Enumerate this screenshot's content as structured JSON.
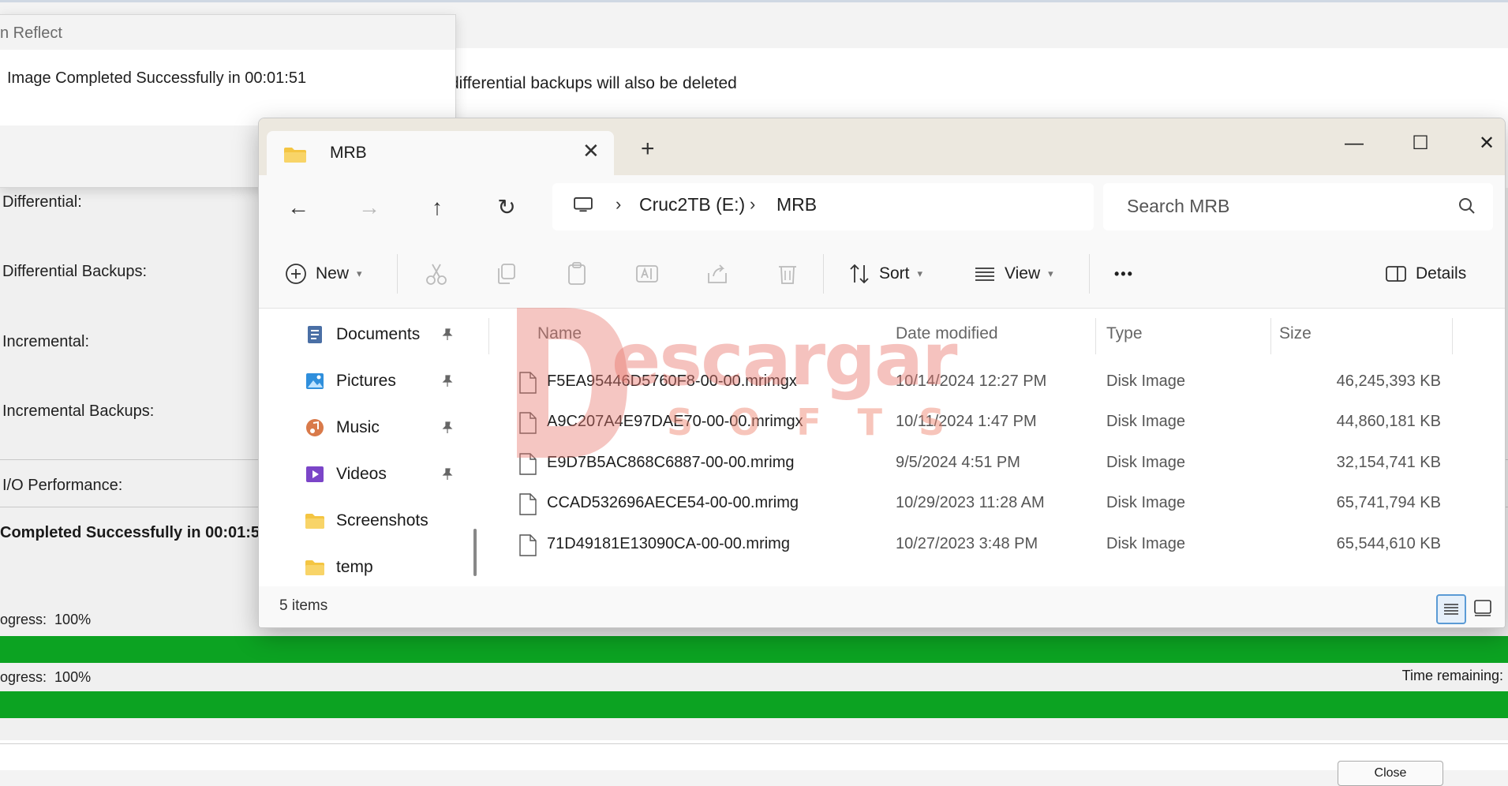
{
  "reflect": {
    "popup_title": "n Reflect",
    "popup_message": "Image Completed Successfully in 00:01:51",
    "note": "differential backups will also be deleted",
    "labels": {
      "differential": "Differential:",
      "differential_backups": "Differential Backups:",
      "incremental": "Incremental:",
      "incremental_backups": "Incremental Backups:",
      "io_performance": "I/O Performance:"
    },
    "completed_text": "Completed Successfully in 00:01:5",
    "progress1": {
      "label": "ogress:",
      "value": "100%",
      "fraction": 1.0
    },
    "progress2": {
      "label": "ogress:",
      "value": "100%",
      "fraction": 1.0
    },
    "time_remaining": "Time remaining:",
    "bottom_button": "Close",
    "bar_color": "#0ca322"
  },
  "explorer": {
    "tab_title": "MRB",
    "window_controls": {
      "minimize": "—",
      "maximize": "☐",
      "close": "✕"
    },
    "nav": {
      "back": "←",
      "forward": "→",
      "up": "↑",
      "refresh": "↻"
    },
    "breadcrumb": [
      "Cruc2TB (E:)",
      "MRB"
    ],
    "breadcrumb_separator": "›",
    "search_placeholder": "Search MRB",
    "commands": {
      "new": "New",
      "sort": "Sort",
      "view": "View",
      "more": "•••",
      "details": "Details"
    },
    "sidebar": [
      {
        "label": "Documents",
        "icon": "documents-icon",
        "pinned": true
      },
      {
        "label": "Pictures",
        "icon": "pictures-icon",
        "pinned": true
      },
      {
        "label": "Music",
        "icon": "music-icon",
        "pinned": true
      },
      {
        "label": "Videos",
        "icon": "videos-icon",
        "pinned": true
      },
      {
        "label": "Screenshots",
        "icon": "folder-icon",
        "pinned": false
      },
      {
        "label": "temp",
        "icon": "folder-icon",
        "pinned": false
      }
    ],
    "columns": {
      "name": "Name",
      "date": "Date modified",
      "type": "Type",
      "size": "Size"
    },
    "files": [
      {
        "name": "F5EA95446D5760F8-00-00.mrimgx",
        "date": "10/14/2024 12:27 PM",
        "type": "Disk Image",
        "size": "46,245,393 KB"
      },
      {
        "name": "A9C207A4E97DAE70-00-00.mrimgx",
        "date": "10/11/2024 1:47 PM",
        "type": "Disk Image",
        "size": "44,860,181 KB"
      },
      {
        "name": "E9D7B5AC868C6887-00-00.mrimg",
        "date": "9/5/2024 4:51 PM",
        "type": "Disk Image",
        "size": "32,154,741 KB"
      },
      {
        "name": "CCAD532696AECE54-00-00.mrimg",
        "date": "10/29/2023 11:28 AM",
        "type": "Disk Image",
        "size": "65,741,794 KB"
      },
      {
        "name": "71D49181E13090CA-00-00.mrimg",
        "date": "10/27/2023 3:48 PM",
        "type": "Disk Image",
        "size": "65,544,610 KB"
      }
    ],
    "status": "5 items",
    "folder_color": "#f4c542",
    "accent": "#5b9bd5"
  },
  "watermark": {
    "main": "escargar",
    "sub": "SOFTS"
  }
}
